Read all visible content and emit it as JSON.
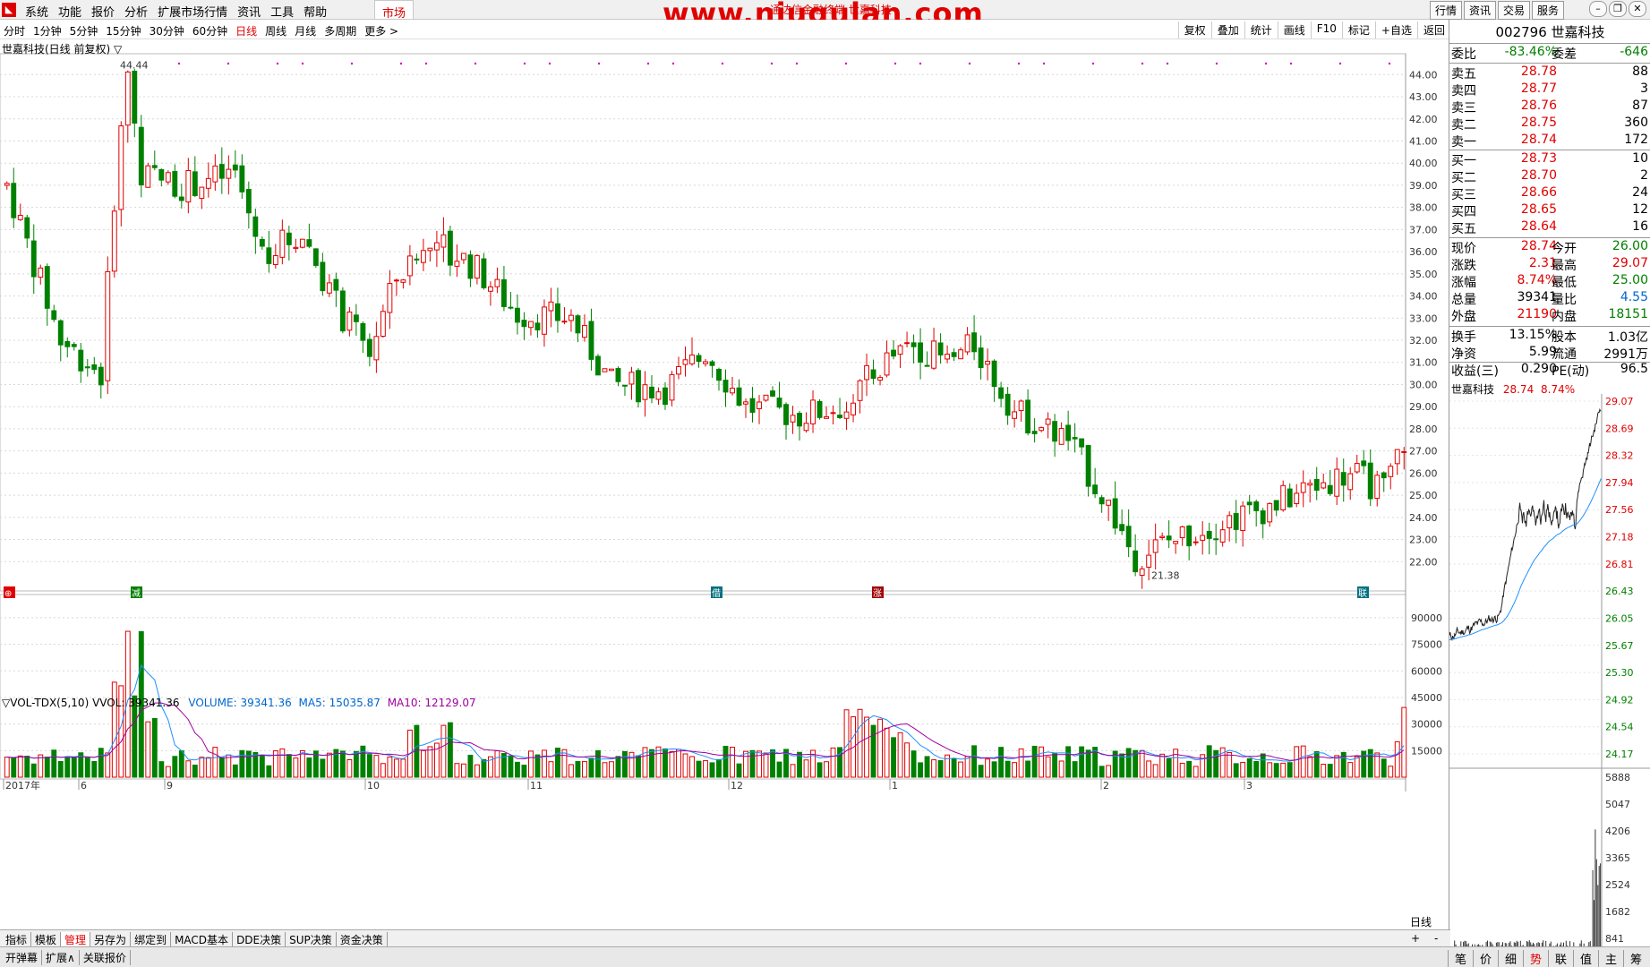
{
  "menubar": {
    "items": [
      "系统",
      "功能",
      "报价",
      "分析",
      "扩展市场行情",
      "资讯",
      "工具",
      "帮助"
    ],
    "market": "市场",
    "watermark": "www.niugulan.com",
    "watermark_sub": "通达信金融终端  世嘉科技",
    "right_buttons": [
      "行情",
      "资讯",
      "交易",
      "服务"
    ],
    "window_buttons": [
      "minimize-icon",
      "restore-icon",
      "close-icon"
    ]
  },
  "periodbar": {
    "items": [
      "分时",
      "1分钟",
      "5分钟",
      "15分钟",
      "30分钟",
      "60分钟",
      "日线",
      "周线",
      "月线",
      "多周期",
      "更多 >"
    ],
    "active": "日线",
    "tools": [
      "复权",
      "叠加",
      "统计",
      "画线",
      "F10",
      "标记",
      "+自选",
      "返回"
    ]
  },
  "chart": {
    "kline_title": "世嘉科技(日线 前复权) ▽",
    "high_label": "44.44",
    "low_label": "21.38",
    "vol_title_prefix": "▽VOL-TDX(5,10)  VVOL: 39341.36",
    "vol_volume": "VOLUME: 39341.36",
    "vol_ma5": "MA5: 15035.87",
    "vol_ma10": "MA10: 12129.07",
    "price_ticks": [
      "44.00",
      "43.00",
      "42.00",
      "41.00",
      "40.00",
      "39.00",
      "38.00",
      "37.00",
      "36.00",
      "35.00",
      "34.00",
      "33.00",
      "32.00",
      "31.00",
      "30.00",
      "29.00",
      "28.00",
      "27.00",
      "26.00",
      "25.00",
      "24.00",
      "23.00",
      "22.00"
    ],
    "vol_ticks": [
      "90000",
      "75000",
      "60000",
      "45000",
      "30000",
      "15000"
    ],
    "date_labels": [
      "2017年",
      "6",
      "9",
      "10",
      "11",
      "12",
      "1",
      "2",
      "3"
    ],
    "event_markers": [
      "⊕",
      "减",
      "借",
      "涨",
      "联"
    ],
    "colors": {
      "up": "#e00000",
      "down": "#008000",
      "ma5": "#1e90ff",
      "ma10": "#a000a0",
      "grid": "#d8d8d8"
    }
  },
  "quote": {
    "title": "002796 世嘉科技",
    "weibi_label": "委比",
    "weibi": "-83.46%",
    "weicha_label": "委差",
    "weicha": "-646",
    "asks": [
      {
        "label": "卖五",
        "price": "28.78",
        "qty": "88"
      },
      {
        "label": "卖四",
        "price": "28.77",
        "qty": "3"
      },
      {
        "label": "卖三",
        "price": "28.76",
        "qty": "87"
      },
      {
        "label": "卖二",
        "price": "28.75",
        "qty": "360"
      },
      {
        "label": "卖一",
        "price": "28.74",
        "qty": "172"
      }
    ],
    "bids": [
      {
        "label": "买一",
        "price": "28.73",
        "qty": "10"
      },
      {
        "label": "买二",
        "price": "28.70",
        "qty": "2"
      },
      {
        "label": "买三",
        "price": "28.66",
        "qty": "24"
      },
      {
        "label": "买四",
        "price": "28.65",
        "qty": "12"
      },
      {
        "label": "买五",
        "price": "28.64",
        "qty": "16"
      }
    ],
    "stats": [
      {
        "l1": "现价",
        "v1": "28.74",
        "c1": "red",
        "l2": "今开",
        "v2": "26.00",
        "c2": "green"
      },
      {
        "l1": "涨跌",
        "v1": "2.31",
        "c1": "red",
        "l2": "最高",
        "v2": "29.07",
        "c2": "red"
      },
      {
        "l1": "涨幅",
        "v1": "8.74%",
        "c1": "red",
        "l2": "最低",
        "v2": "25.00",
        "c2": "green"
      },
      {
        "l1": "总量",
        "v1": "39341",
        "c1": "",
        "l2": "量比",
        "v2": "4.55",
        "c2": "blue"
      },
      {
        "l1": "外盘",
        "v1": "21190",
        "c1": "red",
        "l2": "内盘",
        "v2": "18151",
        "c2": "green"
      }
    ],
    "stats2": [
      {
        "l1": "换手",
        "v1": "13.15%",
        "l2": "股本",
        "v2": "1.03亿"
      },
      {
        "l1": "净资",
        "v1": "5.99",
        "l2": "流通",
        "v2": "2991万"
      },
      {
        "l1": "收益(三)",
        "v1": "0.290",
        "l2": "PE(动)",
        "v2": "96.5"
      }
    ],
    "mini_title_name": "世嘉科技",
    "mini_title_price": "28.74",
    "mini_title_pct": "8.74%",
    "mini_price_ticks": [
      "29.07",
      "28.69",
      "28.32",
      "27.94",
      "27.56",
      "27.18",
      "26.81",
      "26.43",
      "26.05",
      "25.67",
      "25.30",
      "24.92",
      "24.54",
      "24.17"
    ],
    "mini_vol_ticks": [
      "5888",
      "5047",
      "4206",
      "3365",
      "2524",
      "1682",
      "841"
    ]
  },
  "tabbar": {
    "items": [
      "指标",
      "模板",
      "管理",
      "另存为",
      "绑定到",
      "MACD基本",
      "DDE决策",
      "SUP决策",
      "资金决策"
    ],
    "active": "管理",
    "dayline": "日线",
    "plus": "+",
    "minus": "-"
  },
  "bottombar": {
    "items": [
      "开弹幕",
      "扩展∧",
      "关联报价"
    ],
    "mini_tabs": [
      "笔",
      "价",
      "细",
      "势",
      "联",
      "值",
      "主",
      "筹"
    ],
    "mini_active": "势"
  }
}
